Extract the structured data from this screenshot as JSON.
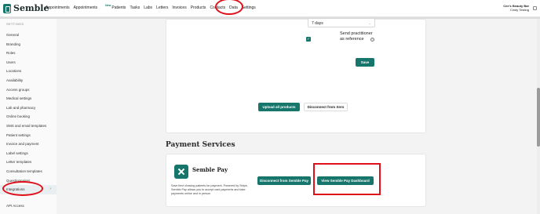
{
  "topbar": {
    "logo": "Semble",
    "nav": [
      {
        "label": "Appointments"
      },
      {
        "label": "Appointments",
        "badge": "New"
      },
      {
        "label": "Patients"
      },
      {
        "label": "Tasks"
      },
      {
        "label": "Labs"
      },
      {
        "label": "Letters"
      },
      {
        "label": "Invoices"
      },
      {
        "label": "Products"
      },
      {
        "label": "Contacts"
      },
      {
        "label": "Data"
      },
      {
        "label": "Settings"
      }
    ],
    "account": {
      "business": "Cee's Beauty Bar",
      "user": "Cindy Testing"
    }
  },
  "sidebar": {
    "title": "SETTINGS",
    "items": [
      {
        "label": "General"
      },
      {
        "label": "Branding"
      },
      {
        "label": "Roles"
      },
      {
        "label": "Users"
      },
      {
        "label": "Locations"
      },
      {
        "label": "Availability"
      },
      {
        "label": "Access groups"
      },
      {
        "label": "Medical settings"
      },
      {
        "label": "Lab and pharmacy"
      },
      {
        "label": "Online booking"
      },
      {
        "label": "SMS and email templates"
      },
      {
        "label": "Patient settings"
      },
      {
        "label": "Invoice and payment"
      },
      {
        "label": "Label settings"
      },
      {
        "label": "Letter templates"
      },
      {
        "label": "Consultation templates"
      },
      {
        "label": "Questionnaires"
      },
      {
        "label": "Integrations"
      }
    ],
    "active_label": "Integrations",
    "bottom_item": "API Access"
  },
  "xero": {
    "reminder_select": "7 days",
    "send_label": "Send practitioner as reference",
    "send_checked": true,
    "save_label": "Save",
    "upload_label": "Upload all products",
    "disconnect_label": "Disconnect from Xero"
  },
  "payment": {
    "heading": "Payment Services",
    "product_name": "Semble Pay",
    "description": "Save time chasing patients for payment. Powered by Stripe, Semble Pay allows you to accept card payments and take payments online and in person",
    "disconnect_label": "Disconnect from Semble Pay",
    "dashboard_label": "View Semble Pay Dashboard"
  },
  "colors": {
    "accent": "#16766b",
    "annotation": "#e0101a"
  }
}
